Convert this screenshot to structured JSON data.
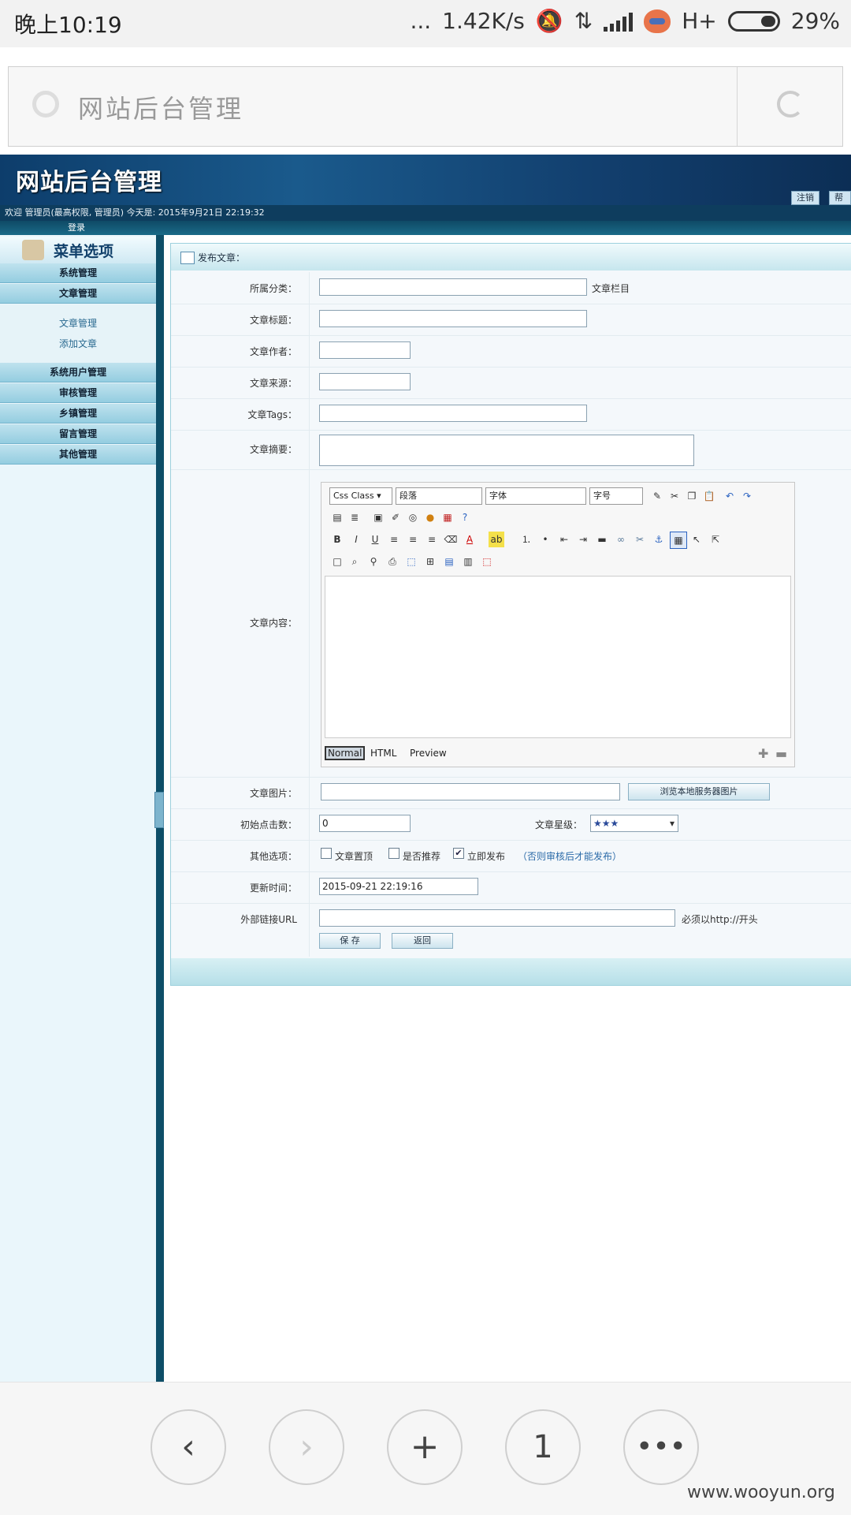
{
  "status_bar": {
    "time": "晚上10:19",
    "dots": "...",
    "speed": "1.42K/s",
    "network": "H+",
    "battery": "29%"
  },
  "browser": {
    "title": "网站后台管理"
  },
  "admin_header": {
    "logo": "网站后台管理",
    "logout": "注销",
    "help": "帮助",
    "welcome": "欢迎 管理员(最高权限, 管理员) 今天是: 2015年9月21日 22:19:32",
    "login": "登录"
  },
  "sidebar": {
    "title": "菜单选项",
    "items": [
      {
        "label": "系统管理"
      },
      {
        "label": "文章管理"
      },
      {
        "label": "系统用户管理"
      },
      {
        "label": "审核管理"
      },
      {
        "label": "乡镇管理"
      },
      {
        "label": "留言管理"
      },
      {
        "label": "其他管理"
      }
    ],
    "sub_items": [
      {
        "label": "文章管理"
      },
      {
        "label": "添加文章"
      }
    ]
  },
  "form": {
    "title": "发布文章：",
    "category_label": "所属分类：",
    "category_note": "文章栏目",
    "title_label": "文章标题：",
    "author_label": "文章作者：",
    "source_label": "文章来源：",
    "tags_label": "文章Tags：",
    "summary_label": "文章摘要：",
    "content_label": "文章内容：",
    "image_label": "文章图片：",
    "browse_button": "浏览本地服务器图片",
    "clicks_label": "初始点击数：",
    "clicks_value": "0",
    "stars_label": "文章星级：",
    "stars_value": "★★★",
    "options_label": "其他选项：",
    "opt_top": "文章置顶",
    "opt_recommend": "是否推荐",
    "opt_publish": "立即发布",
    "opt_note": "（否则审核后才能发布）",
    "time_label": "更新时间：",
    "time_value": "2015-09-21 22:19:16",
    "url_label": "外部链接URL",
    "url_note": "必须以http://开头",
    "save_button": "保 存",
    "back_button": "返回"
  },
  "editor": {
    "css_class": "Css Class",
    "paragraph": "段落",
    "font": "字体",
    "size": "字号",
    "tab_normal": "Normal",
    "tab_html": "HTML",
    "tab_preview": "Preview"
  },
  "bottom_nav": {
    "tab_count": "1"
  },
  "watermark": "www.wooyun.org"
}
